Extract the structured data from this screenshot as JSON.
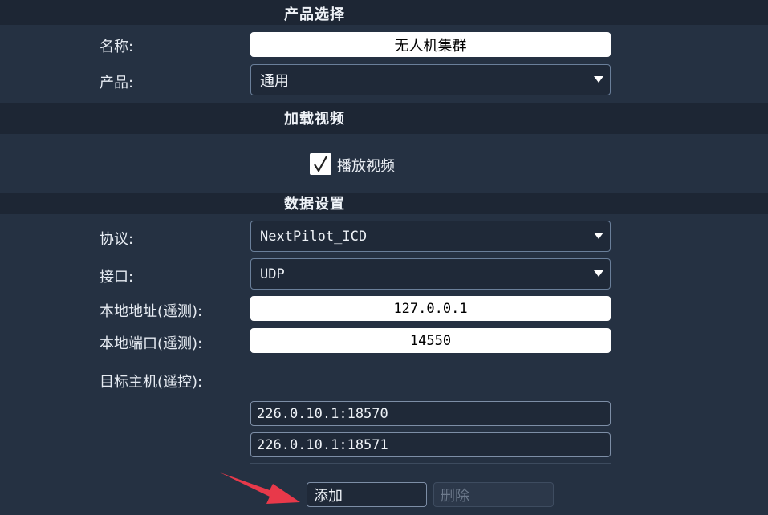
{
  "sections": {
    "product": "产品选择",
    "video": "加载视频",
    "data": "数据设置"
  },
  "product": {
    "name_label": "名称:",
    "name_value": "无人机集群",
    "product_label": "产品:",
    "product_value": "通用"
  },
  "video": {
    "play_label": "播放视频",
    "play_checked": true
  },
  "data": {
    "protocol_label": "协议:",
    "protocol_value": "NextPilot_ICD",
    "port_label": "接口:",
    "port_value": "UDP",
    "local_addr_label": "本地地址(遥测):",
    "local_addr_value": "127.0.0.1",
    "local_port_label": "本地端口(遥测):",
    "local_port_value": "14550",
    "target_label": "目标主机(遥控):",
    "target_hosts": [
      "226.0.10.1:18570",
      "226.0.10.1:18571"
    ]
  },
  "buttons": {
    "add": "添加",
    "delete": "删除"
  },
  "colors": {
    "panel_bg": "#253142",
    "header_bg": "#1d2634",
    "annotation_arrow": "#e8394a"
  }
}
